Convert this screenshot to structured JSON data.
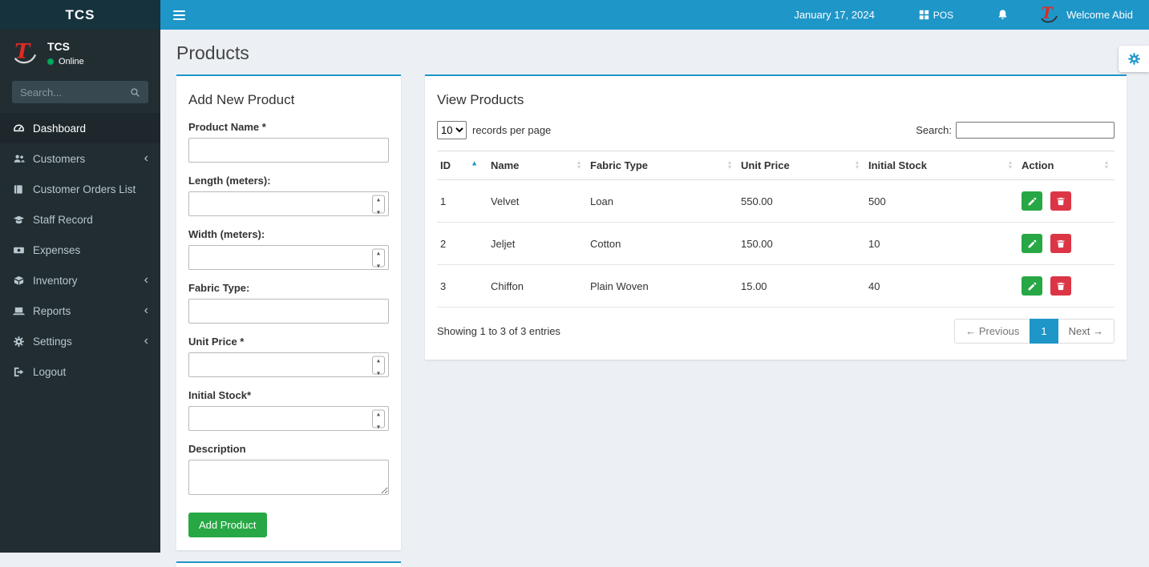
{
  "topbar": {
    "brand": "TCS",
    "date": "January 17, 2024",
    "pos_label": "POS",
    "welcome": "Welcome Abid"
  },
  "sidebar": {
    "brand": "TCS",
    "status": "Online",
    "search_placeholder": "Search...",
    "items": [
      {
        "label": "Dashboard"
      },
      {
        "label": "Customers"
      },
      {
        "label": "Customer Orders List"
      },
      {
        "label": "Staff Record"
      },
      {
        "label": "Expenses"
      },
      {
        "label": "Inventory"
      },
      {
        "label": "Reports"
      },
      {
        "label": "Settings"
      },
      {
        "label": "Logout"
      }
    ]
  },
  "page": {
    "title": "Products"
  },
  "add_product": {
    "title": "Add New Product",
    "fields": [
      {
        "label": "Product Name *"
      },
      {
        "label": "Length (meters):"
      },
      {
        "label": "Width (meters):"
      },
      {
        "label": "Fabric Type:"
      },
      {
        "label": "Unit Price *"
      },
      {
        "label": "Initial Stock*"
      },
      {
        "label": "Description"
      }
    ],
    "submit_label": "Add Product"
  },
  "view_products": {
    "title": "View Products",
    "page_size": "10",
    "records_label": "records per page",
    "search_label": "Search:",
    "columns": [
      "ID",
      "Name",
      "Fabric Type",
      "Unit Price",
      "Initial Stock",
      "Action"
    ],
    "rows": [
      {
        "id": "1",
        "name": "Velvet",
        "fabric_type": "Loan",
        "unit_price": "550.00",
        "initial_stock": "500"
      },
      {
        "id": "2",
        "name": "Jeljet",
        "fabric_type": "Cotton",
        "unit_price": "150.00",
        "initial_stock": "10"
      },
      {
        "id": "3",
        "name": "Chiffon",
        "fabric_type": "Plain Woven",
        "unit_price": "15.00",
        "initial_stock": "40"
      }
    ],
    "summary": "Showing 1 to 3 of 3 entries",
    "pagination": {
      "previous": "← Previous",
      "current": "1",
      "next": "Next →"
    }
  },
  "colors": {
    "topbar_blue": "#1e96c8",
    "success_green": "#28a745",
    "danger_red": "#dc3545",
    "sidebar_bg": "#222d32"
  }
}
